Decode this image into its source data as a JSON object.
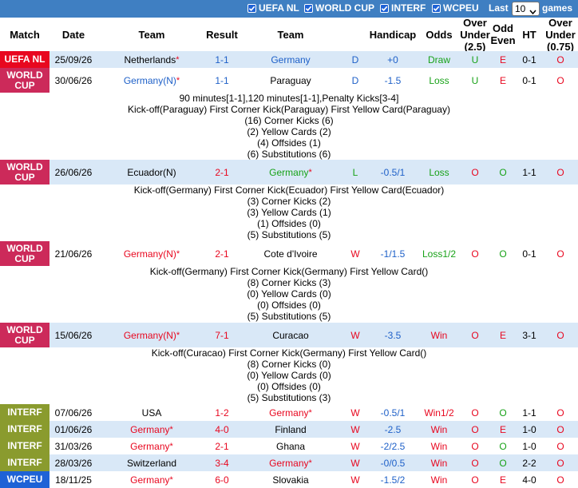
{
  "filters": [
    {
      "label": "UEFA NL",
      "checked": true
    },
    {
      "label": "WORLD CUP",
      "checked": true
    },
    {
      "label": "INTERF",
      "checked": true
    },
    {
      "label": "WCPEU",
      "checked": true
    }
  ],
  "last_label": "Last",
  "games_count": "10",
  "games_label": "games",
  "headers": {
    "match": "Match",
    "date": "Date",
    "team": "Team",
    "result": "Result",
    "team2": "Team",
    "handicap": "Handicap",
    "odds": "Odds",
    "over_under": "Over Under (2.5)",
    "odd_even": "Odd Even",
    "ht": "HT",
    "over_075": "Over Under (0.75)"
  },
  "colors": {
    "topbar": "#3f7fc2",
    "uefa_nl": "#e8071f",
    "world_cup": "#cc2a5a",
    "interf": "#8a9b2e",
    "wcpeu": "#1e62d6",
    "row_light": "#d9e8f7",
    "row_white": "#ffffff",
    "win_green": "#18a218",
    "loss_red": "#e8071f",
    "team_blue": "#1e60c8"
  },
  "matches": [
    {
      "comp": "UEFA NL",
      "date": "25/09/26",
      "home": "Netherlands",
      "home_star": "*",
      "home_color": "black",
      "score": "1-1",
      "score_color": "blue",
      "away": "Germany",
      "away_star": "",
      "away_color": "blue",
      "wl": "D",
      "wl_color": "blue",
      "handicap": "+0",
      "hc_color": "blue",
      "odds": "Draw",
      "odds_color": "green",
      "ou": "U",
      "ou_color": "green",
      "oe": "E",
      "oe_color": "red",
      "ht": "0-1",
      "o75": "O",
      "o75_color": "red",
      "details": []
    },
    {
      "comp": "WORLD CUP",
      "date": "30/06/26",
      "home": "Germany(N)",
      "home_star": "*",
      "home_color": "blue",
      "score": "1-1",
      "score_color": "blue",
      "away": "Paraguay",
      "away_star": "",
      "away_color": "black",
      "wl": "D",
      "wl_color": "blue",
      "handicap": "-1.5",
      "hc_color": "blue",
      "odds": "Loss",
      "odds_color": "green",
      "ou": "U",
      "ou_color": "green",
      "oe": "E",
      "oe_color": "red",
      "ht": "0-1",
      "o75": "O",
      "o75_color": "red",
      "details": [
        "90 minutes[1-1],120 minutes[1-1],Penalty Kicks[3-4]",
        "Kick-off(Paraguay)   First Corner Kick(Paraguay)   First Yellow Card(Paraguay)",
        "(16) Corner Kicks (6)",
        "(2) Yellow Cards (2)",
        "(4) Offsides (1)",
        "(6) Substitutions (6)"
      ]
    },
    {
      "comp": "WORLD CUP",
      "date": "26/06/26",
      "home": "Ecuador(N)",
      "home_star": "",
      "home_color": "black",
      "score": "2-1",
      "score_color": "red",
      "away": "Germany",
      "away_star": "*",
      "away_color": "green",
      "wl": "L",
      "wl_color": "green",
      "handicap": "-0.5/1",
      "hc_color": "blue",
      "odds": "Loss",
      "odds_color": "green",
      "ou": "O",
      "ou_color": "red",
      "oe": "O",
      "oe_color": "green",
      "ht": "1-1",
      "o75": "O",
      "o75_color": "red",
      "details": [
        "Kick-off(Germany)   First Corner Kick(Ecuador)   First Yellow Card(Ecuador)",
        "(3) Corner Kicks (2)",
        "(3) Yellow Cards (1)",
        "(1) Offsides (0)",
        "(5) Substitutions (5)"
      ]
    },
    {
      "comp": "WORLD CUP",
      "date": "21/06/26",
      "home": "Germany(N)",
      "home_star": "*",
      "home_color": "red",
      "score": "2-1",
      "score_color": "red",
      "away": "Cote d'Ivoire",
      "away_star": "",
      "away_color": "black",
      "wl": "W",
      "wl_color": "red",
      "handicap": "-1/1.5",
      "hc_color": "blue",
      "odds": "Loss1/2",
      "odds_color": "green",
      "ou": "O",
      "ou_color": "red",
      "oe": "O",
      "oe_color": "green",
      "ht": "0-1",
      "o75": "O",
      "o75_color": "red",
      "details": [
        "Kick-off(Germany)   First Corner Kick(Germany)   First Yellow Card()",
        "(8) Corner Kicks (3)",
        "(0) Yellow Cards (0)",
        "(0) Offsides (0)",
        "(5) Substitutions (5)"
      ]
    },
    {
      "comp": "WORLD CUP",
      "date": "15/06/26",
      "home": "Germany(N)",
      "home_star": "*",
      "home_color": "red",
      "score": "7-1",
      "score_color": "red",
      "away": "Curacao",
      "away_star": "",
      "away_color": "black",
      "wl": "W",
      "wl_color": "red",
      "handicap": "-3.5",
      "hc_color": "blue",
      "odds": "Win",
      "odds_color": "red",
      "ou": "O",
      "ou_color": "red",
      "oe": "E",
      "oe_color": "red",
      "ht": "3-1",
      "o75": "O",
      "o75_color": "red",
      "details": [
        "Kick-off(Curacao)   First Corner Kick(Germany)   First Yellow Card()",
        "(8) Corner Kicks (0)",
        "(0) Yellow Cards (0)",
        "(0) Offsides (0)",
        "(5) Substitutions (3)"
      ]
    },
    {
      "comp": "INTERF",
      "date": "07/06/26",
      "home": "USA",
      "home_star": "",
      "home_color": "black",
      "score": "1-2",
      "score_color": "red",
      "away": "Germany",
      "away_star": "*",
      "away_color": "red",
      "wl": "W",
      "wl_color": "red",
      "handicap": "-0.5/1",
      "hc_color": "blue",
      "odds": "Win1/2",
      "odds_color": "red",
      "ou": "O",
      "ou_color": "red",
      "oe": "O",
      "oe_color": "green",
      "ht": "1-1",
      "o75": "O",
      "o75_color": "red",
      "details": []
    },
    {
      "comp": "INTERF",
      "date": "01/06/26",
      "home": "Germany",
      "home_star": "*",
      "home_color": "red",
      "score": "4-0",
      "score_color": "red",
      "away": "Finland",
      "away_star": "",
      "away_color": "black",
      "wl": "W",
      "wl_color": "red",
      "handicap": "-2.5",
      "hc_color": "blue",
      "odds": "Win",
      "odds_color": "red",
      "ou": "O",
      "ou_color": "red",
      "oe": "E",
      "oe_color": "red",
      "ht": "1-0",
      "o75": "O",
      "o75_color": "red",
      "details": []
    },
    {
      "comp": "INTERF",
      "date": "31/03/26",
      "home": "Germany",
      "home_star": "*",
      "home_color": "red",
      "score": "2-1",
      "score_color": "red",
      "away": "Ghana",
      "away_star": "",
      "away_color": "black",
      "wl": "W",
      "wl_color": "red",
      "handicap": "-2/2.5",
      "hc_color": "blue",
      "odds": "Win",
      "odds_color": "red",
      "ou": "O",
      "ou_color": "red",
      "oe": "O",
      "oe_color": "green",
      "ht": "1-0",
      "o75": "O",
      "o75_color": "red",
      "details": []
    },
    {
      "comp": "INTERF",
      "date": "28/03/26",
      "home": "Switzerland",
      "home_star": "",
      "home_color": "black",
      "score": "3-4",
      "score_color": "red",
      "away": "Germany",
      "away_star": "*",
      "away_color": "red",
      "wl": "W",
      "wl_color": "red",
      "handicap": "-0/0.5",
      "hc_color": "blue",
      "odds": "Win",
      "odds_color": "red",
      "ou": "O",
      "ou_color": "red",
      "oe": "O",
      "oe_color": "green",
      "ht": "2-2",
      "o75": "O",
      "o75_color": "red",
      "details": []
    },
    {
      "comp": "WCPEU",
      "date": "18/11/25",
      "home": "Germany",
      "home_star": "*",
      "home_color": "red",
      "score": "6-0",
      "score_color": "red",
      "away": "Slovakia",
      "away_star": "",
      "away_color": "black",
      "wl": "W",
      "wl_color": "red",
      "handicap": "-1.5/2",
      "hc_color": "blue",
      "odds": "Win",
      "odds_color": "red",
      "ou": "O",
      "ou_color": "red",
      "oe": "E",
      "oe_color": "red",
      "ht": "4-0",
      "o75": "O",
      "o75_color": "red",
      "details": []
    }
  ]
}
